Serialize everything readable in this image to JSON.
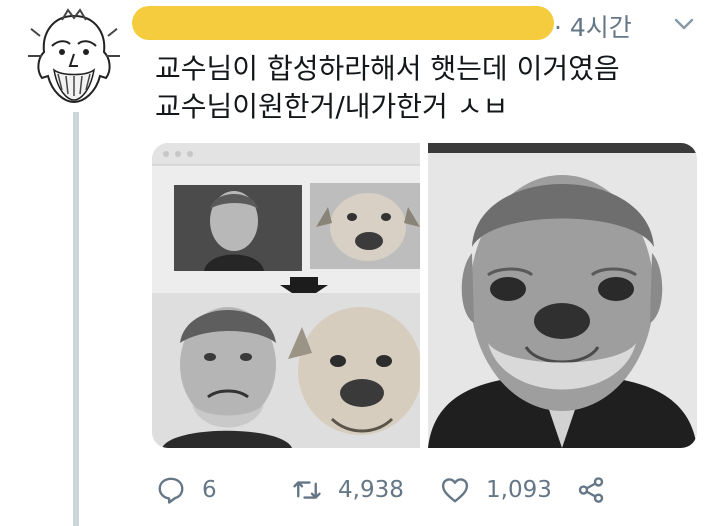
{
  "tweet": {
    "time": "· 4시간",
    "text_lines": [
      "교수님이 합성하라해서 햇는데 이거였음",
      "교수님이원한거/내가한거 ㅅㅂ"
    ]
  },
  "actions": {
    "reply_count": "6",
    "retweet_count": "4,938",
    "like_count": "1,093"
  },
  "icons": {
    "avatar": "cartoon-old-man-avatar",
    "caret": "chevron-down-icon",
    "reply": "reply-icon",
    "retweet": "retweet-icon",
    "like": "heart-icon",
    "share": "share-icon"
  },
  "colors": {
    "muted": "#657786",
    "redaction": "#f5cc3d",
    "thread_line": "#ccd6dd"
  }
}
